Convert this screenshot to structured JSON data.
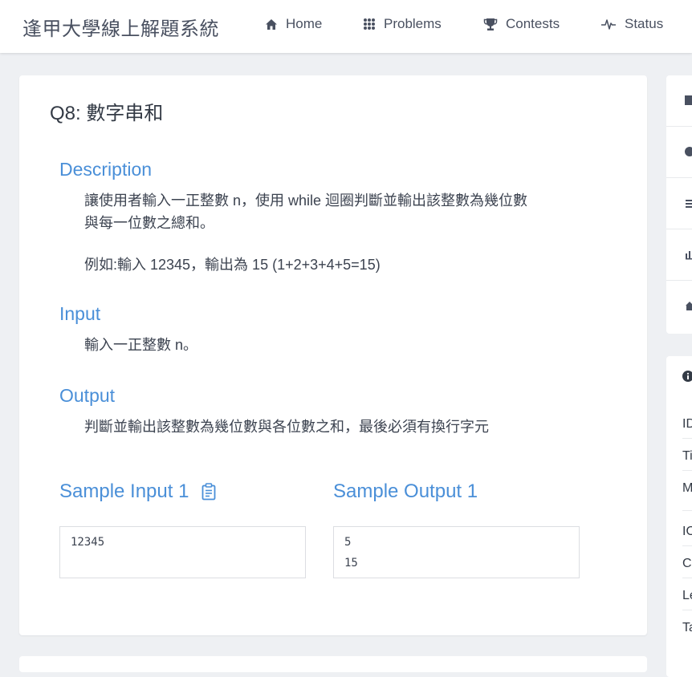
{
  "header": {
    "brand": "逢甲大學線上解題系統",
    "nav": [
      {
        "label": "Home",
        "icon": "home-icon"
      },
      {
        "label": "Problems",
        "icon": "grid-icon"
      },
      {
        "label": "Contests",
        "icon": "trophy-icon"
      },
      {
        "label": "Status",
        "icon": "pulse-icon"
      }
    ]
  },
  "problem": {
    "title": "Q8: 數字串和",
    "description": {
      "heading": "Description",
      "line1": "讓使用者輸入一正整數 n，使用 while 迴圈判斷並輸出該整數為幾位數",
      "line2": "與每一位數之總和。",
      "example": "例如:輸入 12345，輸出為 15 (1+2+3+4+5=15)"
    },
    "input": {
      "heading": "Input",
      "text": "輸入一正整數 n。"
    },
    "output": {
      "heading": "Output",
      "text": "判斷並輸出該整數為幾位數與各位數之和，最後必須有換行字元"
    },
    "samples": {
      "input_title": "Sample Input 1",
      "output_title": "Sample Output 1",
      "input_lines": [
        "12345"
      ],
      "output_lines": [
        "5",
        "15"
      ]
    }
  },
  "sidebar": {
    "info_labels": [
      "ID",
      "Ti",
      "M",
      "IO",
      "Cr",
      "Le",
      "Ta"
    ]
  },
  "colors": {
    "accent": "#4a8fd8",
    "text": "#495060",
    "background": "#eef0f3"
  }
}
